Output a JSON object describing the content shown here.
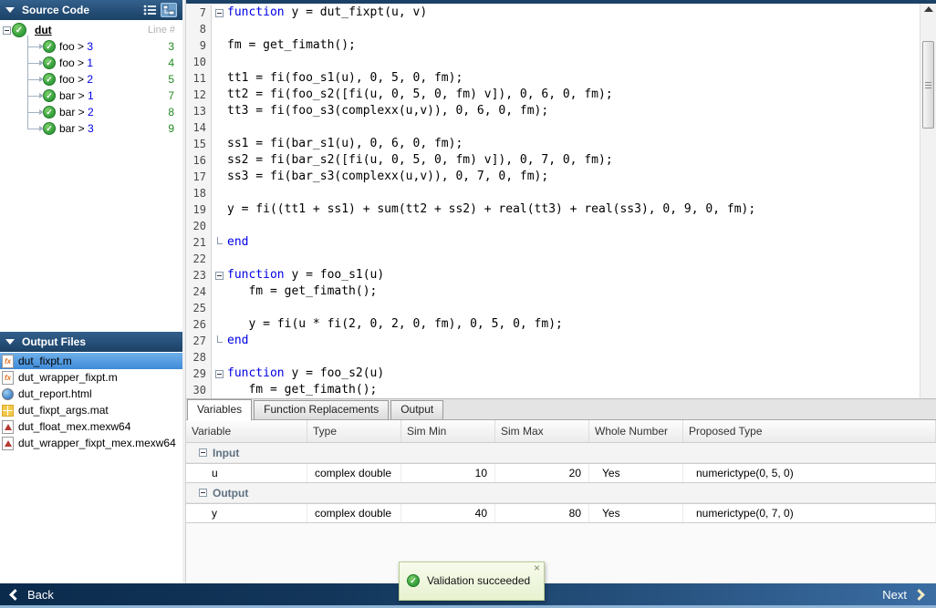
{
  "colors": {
    "panel_header_blue": "#24517c",
    "selection_blue": "#4d9ae2",
    "keyword_blue": "#0000e6",
    "tree_line_number_green": "#1f8a1f",
    "success_green": "#3aa33f",
    "footer_left_navy": "#0b2b4c",
    "footer_right_blue": "#3b6da3",
    "toast_background": "#eef7df"
  },
  "source_code_panel": {
    "title": "Source Code",
    "line_header": "Line #",
    "root": {
      "label": "dut"
    },
    "items": [
      {
        "prefix": "foo >",
        "index": "3",
        "line": "3"
      },
      {
        "prefix": "foo >",
        "index": "1",
        "line": "4"
      },
      {
        "prefix": "foo >",
        "index": "2",
        "line": "5"
      },
      {
        "prefix": "bar >",
        "index": "1",
        "line": "7"
      },
      {
        "prefix": "bar >",
        "index": "2",
        "line": "8"
      },
      {
        "prefix": "bar >",
        "index": "3",
        "line": "9"
      }
    ]
  },
  "output_files_panel": {
    "title": "Output Files",
    "files": [
      {
        "name": "dut_fixpt.m",
        "icon": "matlab-file",
        "selected": true
      },
      {
        "name": "dut_wrapper_fixpt.m",
        "icon": "matlab-file",
        "selected": false
      },
      {
        "name": "dut_report.html",
        "icon": "html-file",
        "selected": false
      },
      {
        "name": "dut_fixpt_args.mat",
        "icon": "mat-file",
        "selected": false
      },
      {
        "name": "dut_float_mex.mexw64",
        "icon": "mex-file",
        "selected": false
      },
      {
        "name": "dut_wrapper_fixpt_mex.mexw64",
        "icon": "mex-file",
        "selected": false
      }
    ]
  },
  "editor": {
    "lines": [
      {
        "n": 7,
        "fold": "open",
        "seg": [
          [
            "k",
            "function"
          ],
          [
            "p",
            " y = dut_fixpt(u, v)"
          ]
        ]
      },
      {
        "n": 8,
        "seg": []
      },
      {
        "n": 9,
        "seg": [
          [
            "p",
            "fm = get_fimath();"
          ]
        ]
      },
      {
        "n": 10,
        "seg": []
      },
      {
        "n": 11,
        "seg": [
          [
            "p",
            "tt1 = fi(foo_s1(u), 0, 5, 0, fm);"
          ]
        ]
      },
      {
        "n": 12,
        "seg": [
          [
            "p",
            "tt2 = fi(foo_s2([fi(u, 0, 5, 0, fm) v]), 0, 6, 0, fm);"
          ]
        ]
      },
      {
        "n": 13,
        "seg": [
          [
            "p",
            "tt3 = fi(foo_s3(complexx(u,v)), 0, 6, 0, fm);"
          ]
        ]
      },
      {
        "n": 14,
        "seg": []
      },
      {
        "n": 15,
        "seg": [
          [
            "p",
            "ss1 = fi(bar_s1(u), 0, 6, 0, fm);"
          ]
        ]
      },
      {
        "n": 16,
        "seg": [
          [
            "p",
            "ss2 = fi(bar_s2([fi(u, 0, 5, 0, fm) v]), 0, 7, 0, fm);"
          ]
        ]
      },
      {
        "n": 17,
        "seg": [
          [
            "p",
            "ss3 = fi(bar_s3(complexx(u,v)), 0, 7, 0, fm);"
          ]
        ]
      },
      {
        "n": 18,
        "seg": []
      },
      {
        "n": 19,
        "seg": [
          [
            "p",
            "y = fi((tt1 + ss1) + sum(tt2 + ss2) + real(tt3) + real(ss3), 0, 9, 0, fm);"
          ]
        ]
      },
      {
        "n": 20,
        "seg": []
      },
      {
        "n": 21,
        "fold": "end",
        "seg": [
          [
            "k",
            "end"
          ]
        ]
      },
      {
        "n": 22,
        "seg": []
      },
      {
        "n": 23,
        "fold": "open",
        "seg": [
          [
            "k",
            "function"
          ],
          [
            "p",
            " y = foo_s1(u)"
          ]
        ]
      },
      {
        "n": 24,
        "seg": [
          [
            "p",
            "   fm = get_fimath();"
          ]
        ]
      },
      {
        "n": 25,
        "seg": []
      },
      {
        "n": 26,
        "seg": [
          [
            "p",
            "   y = fi(u * fi(2, 0, 2, 0, fm), 0, 5, 0, fm);"
          ]
        ]
      },
      {
        "n": 27,
        "fold": "end",
        "seg": [
          [
            "k",
            "end"
          ]
        ]
      },
      {
        "n": 28,
        "seg": []
      },
      {
        "n": 29,
        "fold": "open",
        "seg": [
          [
            "k",
            "function"
          ],
          [
            "p",
            " y = foo_s2(u)"
          ]
        ]
      },
      {
        "n": 30,
        "seg": [
          [
            "p",
            "   fm = get_fimath();"
          ]
        ]
      }
    ]
  },
  "bottom_panel": {
    "tabs": [
      {
        "label": "Variables",
        "active": true
      },
      {
        "label": "Function Replacements",
        "active": false
      },
      {
        "label": "Output",
        "active": false
      }
    ],
    "columns": [
      "Variable",
      "Type",
      "Sim Min",
      "Sim Max",
      "Whole Number",
      "Proposed Type"
    ],
    "groups": [
      {
        "label": "Input",
        "rows": [
          {
            "variable": "u",
            "type": "complex double",
            "sim_min": "10",
            "sim_max": "20",
            "whole_number": "Yes",
            "proposed_type": "numerictype(0, 5, 0)"
          }
        ]
      },
      {
        "label": "Output",
        "rows": [
          {
            "variable": "y",
            "type": "complex double",
            "sim_min": "40",
            "sim_max": "80",
            "whole_number": "Yes",
            "proposed_type": "numerictype(0, 7, 0)"
          }
        ]
      }
    ]
  },
  "toast": {
    "message": "Validation succeeded",
    "close": "×"
  },
  "footer": {
    "back_label": "Back",
    "next_label": "Next"
  }
}
